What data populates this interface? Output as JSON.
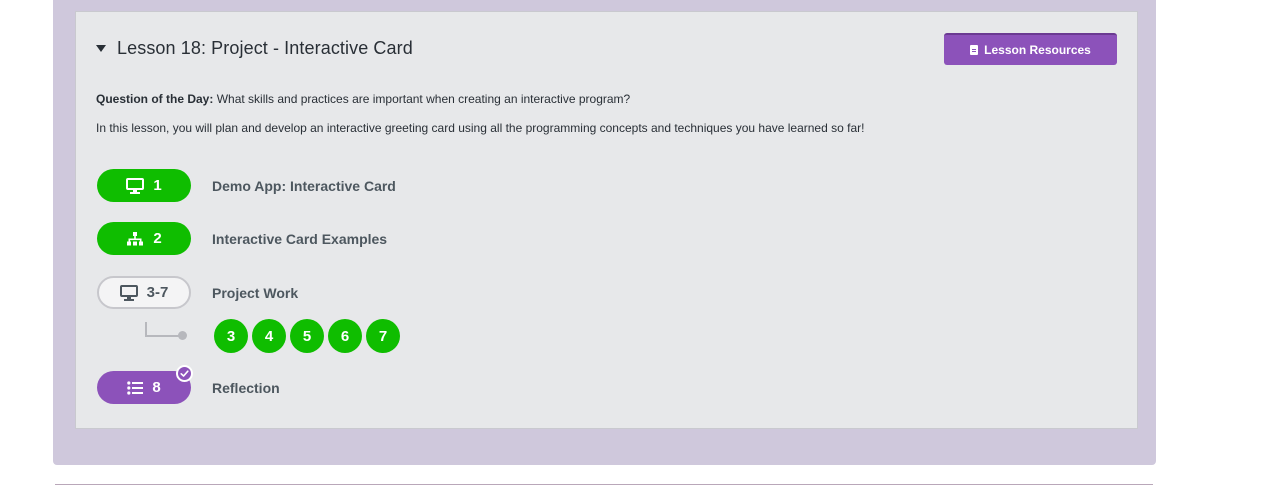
{
  "lesson": {
    "title": "Lesson 18: Project - Interactive Card",
    "resources_label": "Lesson Resources",
    "question_label": "Question of the Day:",
    "question_text": "What skills and practices are important when creating an interactive program?",
    "description": "In this lesson, you will plan and develop an interactive greeting card using all the programming concepts and techniques you have learned so far!"
  },
  "levels": [
    {
      "number": "1",
      "label": "Demo App: Interactive Card",
      "icon": "desktop-icon",
      "status": "completed"
    },
    {
      "number": "2",
      "label": "Interactive Card Examples",
      "icon": "sitemap-icon",
      "status": "completed"
    },
    {
      "number": "3-7",
      "label": "Project Work",
      "icon": "desktop-icon",
      "status": "not-started"
    },
    {
      "number": "8",
      "label": "Reflection",
      "icon": "list-icon",
      "status": "assessment-submitted"
    }
  ],
  "sublevels": [
    "3",
    "4",
    "5",
    "6",
    "7"
  ],
  "colors": {
    "accent_purple": "#8c52ba",
    "completed_green": "#0fbd00",
    "outer_background": "#cfc8dc",
    "card_background": "#e7e8ea"
  }
}
